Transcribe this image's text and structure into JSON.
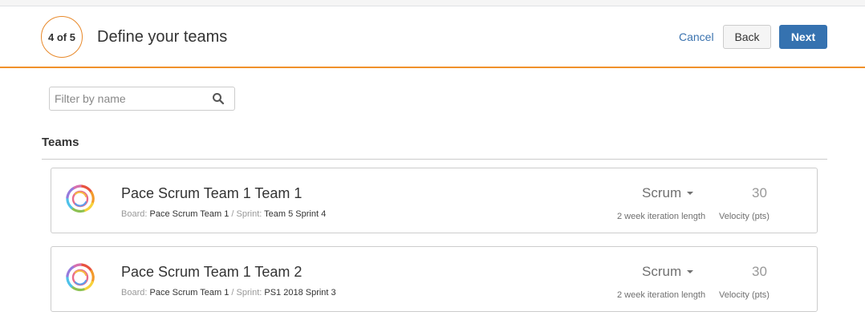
{
  "header": {
    "step": "4 of 5",
    "title": "Define your teams",
    "cancel_label": "Cancel",
    "back_label": "Back",
    "next_label": "Next"
  },
  "filter": {
    "placeholder": "Filter by name",
    "value": ""
  },
  "teams_heading": "Teams",
  "labels": {
    "board": "Board:",
    "separator": "/",
    "sprint": "Sprint:",
    "velocity": "Velocity (pts)"
  },
  "teams": [
    {
      "name": "Pace Scrum Team 1 Team 1",
      "board": "Pace Scrum Team 1",
      "sprint": "Team 5 Sprint 4",
      "method": "Scrum",
      "iteration": "2 week iteration length",
      "velocity": "30"
    },
    {
      "name": "Pace Scrum Team 1 Team 2",
      "board": "Pace Scrum Team 1",
      "sprint": "PS1 2018 Sprint 3",
      "method": "Scrum",
      "iteration": "2 week iteration length",
      "velocity": "30"
    }
  ],
  "colors": {
    "accent": "#f0912b",
    "primary_button": "#3572b0",
    "link": "#3b73af"
  },
  "icons": {
    "search": "search-icon",
    "team_avatar": "team-avatar-icon",
    "dropdown": "caret-down-icon"
  }
}
